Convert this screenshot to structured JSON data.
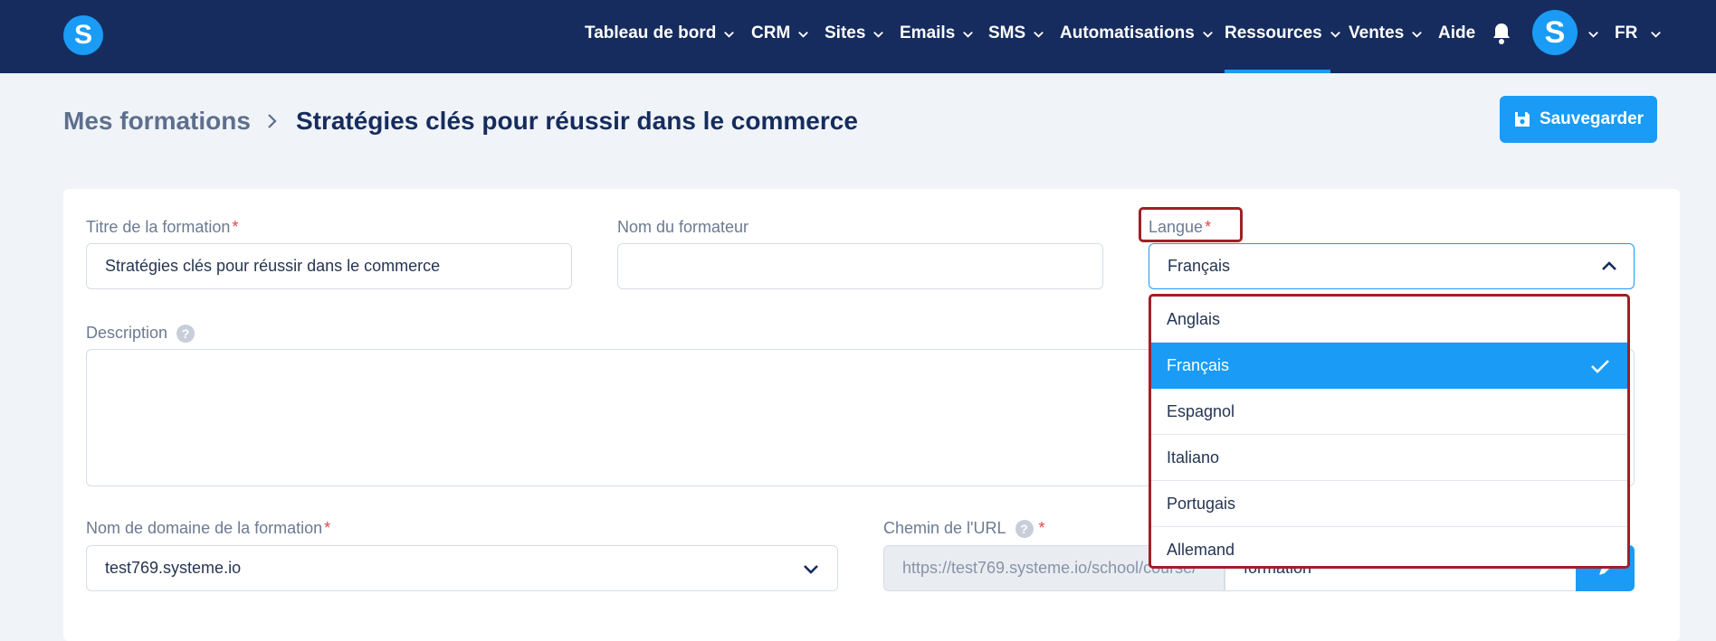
{
  "nav": {
    "items": [
      {
        "label": "Tableau de bord",
        "dropdown": true
      },
      {
        "label": "CRM",
        "dropdown": true
      },
      {
        "label": "Sites",
        "dropdown": true
      },
      {
        "label": "Emails",
        "dropdown": true
      },
      {
        "label": "SMS",
        "dropdown": true
      },
      {
        "label": "Automatisations",
        "dropdown": true
      },
      {
        "label": "Ressources",
        "dropdown": true,
        "active": true
      },
      {
        "label": "Ventes",
        "dropdown": true
      },
      {
        "label": "Aide",
        "dropdown": false
      }
    ],
    "logo_letter": "S",
    "avatar_letter": "S",
    "language": "FR"
  },
  "header": {
    "breadcrumb_root": "Mes formations",
    "title": "Stratégies clés pour réussir dans le commerce",
    "save_label": "Sauvegarder"
  },
  "form": {
    "title_label": "Titre de la formation",
    "title_value": "Stratégies clés pour réussir dans le commerce",
    "instructor_label": "Nom du formateur",
    "instructor_value": "",
    "language_label": "Langue",
    "language_value": "Français",
    "description_label": "Description",
    "description_value": "",
    "domain_label": "Nom de domaine de la formation",
    "domain_value": "test769.systeme.io",
    "url_label": "Chemin de l'URL",
    "url_prefix": "https://test769.systeme.io/school/course/",
    "url_value": "formation",
    "required_mark": "*",
    "help_mark": "?"
  },
  "language_options": [
    {
      "label": "Anglais",
      "selected": false
    },
    {
      "label": "Français",
      "selected": true
    },
    {
      "label": "Espagnol",
      "selected": false
    },
    {
      "label": "Italiano",
      "selected": false
    },
    {
      "label": "Portugais",
      "selected": false
    },
    {
      "label": "Allemand",
      "selected": false
    }
  ],
  "colors": {
    "nav_bg": "#162c5e",
    "accent": "#1a9bf5",
    "highlight_box": "#a11f26",
    "page_bg": "#f0f4f8"
  }
}
